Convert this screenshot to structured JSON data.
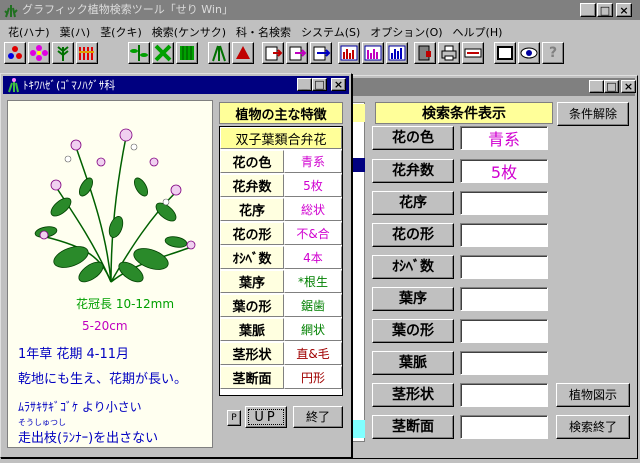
{
  "app": {
    "title": "グラフィック植物検索ツール「せり Win」",
    "menu": [
      "花(ハナ)",
      "葉(ハ)",
      "茎(クキ)",
      "検索(ケンサク)",
      "科・名検索",
      "システム(S)",
      "オプション(O)",
      "ヘルプ(H)"
    ]
  },
  "search_window": {
    "header": "検索条件表示",
    "clear_button": "条件解除",
    "rows": [
      {
        "label": "花の色",
        "value": "青系"
      },
      {
        "label": "花弁数",
        "value": "5枚"
      },
      {
        "label": "花序",
        "value": ""
      },
      {
        "label": "花の形",
        "value": ""
      },
      {
        "label": "ｵｼﾍﾞ数",
        "value": ""
      },
      {
        "label": "葉序",
        "value": ""
      },
      {
        "label": "葉の形",
        "value": ""
      },
      {
        "label": "葉脈",
        "value": ""
      },
      {
        "label": "茎形状",
        "value": ""
      },
      {
        "label": "茎断面",
        "value": ""
      }
    ],
    "illustration_button": "植物図示",
    "end_search_button": "検索終了"
  },
  "plant_window": {
    "title": "ﾄｷﾜﾊｾﾞ(ｺﾞﾏﾉﾊｸﾞｻ科",
    "flower_size": "花冠長 10-12mm",
    "height": "5-20cm",
    "desc1": "1年草 花期 4-11月",
    "desc2": "乾地にも生え、花期が長い。",
    "desc3": "ﾑﾗｻｷｻｷﾞｺﾞｹ より小さい",
    "ruby": "そうしゅつし",
    "desc4": "走出枝(ﾗﾝﾅｰ)を出さない",
    "features_header": "植物の主な特徴",
    "class_label": "双子葉類合弁花",
    "features": [
      {
        "label": "花の色",
        "value": "青系"
      },
      {
        "label": "花弁数",
        "value": "5枚"
      },
      {
        "label": "花序",
        "value": "総状"
      },
      {
        "label": "花の形",
        "value": "不&合"
      },
      {
        "label": "ｵｼﾍﾞ数",
        "value": "4本"
      },
      {
        "label": "葉序",
        "value": "*根生"
      },
      {
        "label": "葉の形",
        "value": "鋸歯"
      },
      {
        "label": "葉脈",
        "value": "網状"
      },
      {
        "label": "茎形状",
        "value": "直&毛"
      },
      {
        "label": "茎断面",
        "value": "円形"
      }
    ],
    "p_button": "P",
    "up_button": "UP",
    "end_button": "終了"
  },
  "colors": {
    "titlebar": "#808080",
    "active_title": "#000080",
    "accent_magenta": "#d000d0",
    "label_blue": "#0000c0",
    "header_yellow": "#ffff99",
    "cell_yellow": "#ffffe0"
  }
}
